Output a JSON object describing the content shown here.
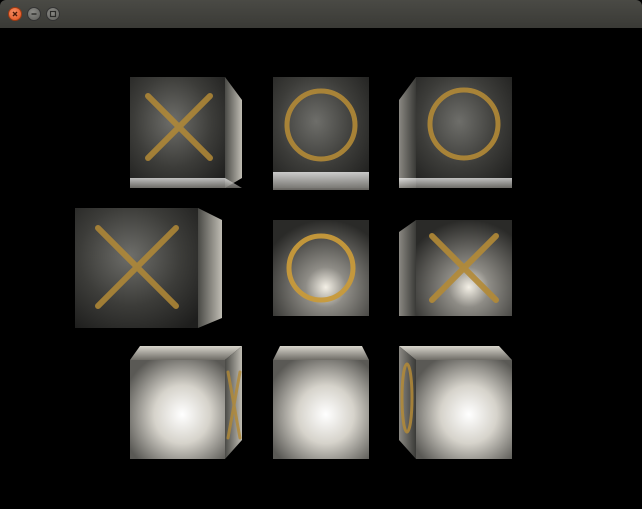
{
  "window": {
    "title": "",
    "controls": [
      "close-icon",
      "minimize-icon",
      "maximize-icon"
    ]
  },
  "board": {
    "cells": [
      "X",
      "O",
      "O",
      "X",
      "O",
      "X",
      "X",
      "",
      "O"
    ]
  },
  "colors": {
    "titlebar": "#3e3e3a",
    "close": "#e2501b",
    "background": "#000000",
    "mark": "#c89a3a"
  }
}
